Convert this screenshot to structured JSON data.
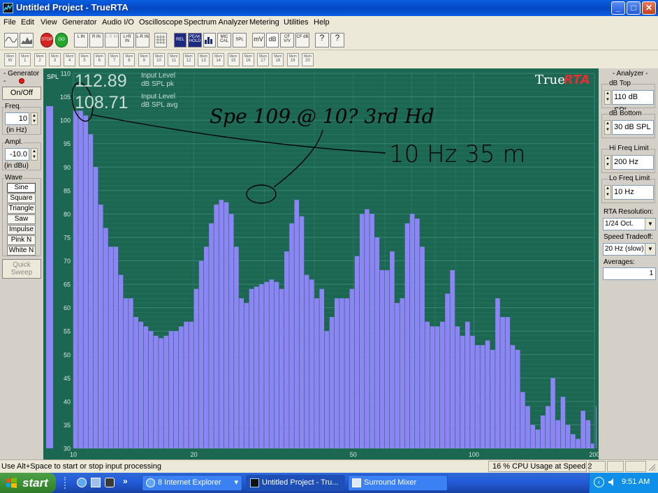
{
  "window": {
    "title": "Untitled Project - TrueRTA",
    "minimize_glyph": "_",
    "maximize_glyph": "□",
    "close_glyph": "✕"
  },
  "menu": [
    "File",
    "Edit",
    "View",
    "Generator",
    "Audio I/O",
    "Oscilloscope",
    "Spectrum Analyzer",
    "Metering",
    "Utilities",
    "Help"
  ],
  "toolbar": {
    "stop": "STOP",
    "go": "GO",
    "l_in": "L IN",
    "r_in": "R IN",
    "l_r_in_disabled": "L R IN",
    "l_plus_r_in": "L+R IN",
    "l_minus_r_in": "L-R IN",
    "rel": "REL",
    "peak_hold": "PEAK HOLD",
    "mic_cal": "MIC CAL",
    "spl": "SPL",
    "mv": "mV",
    "db": "dB",
    "cf_vv": "CF V/V",
    "cf_db": "CF dB",
    "help": "?",
    "context_help": "?"
  },
  "memories": [
    {
      "top": "Mem",
      "num": "W"
    },
    {
      "top": "Mem",
      "num": "1"
    },
    {
      "top": "Mem",
      "num": "2"
    },
    {
      "top": "Mem",
      "num": "3"
    },
    {
      "top": "Mem",
      "num": "4"
    },
    {
      "top": "Mem",
      "num": "5"
    },
    {
      "top": "Mem",
      "num": "6"
    },
    {
      "top": "Mem",
      "num": "7"
    },
    {
      "top": "Mem",
      "num": "8"
    },
    {
      "top": "Mem",
      "num": "9"
    },
    {
      "top": "Mem",
      "num": "10"
    },
    {
      "top": "Mem",
      "num": "11"
    },
    {
      "top": "Mem",
      "num": "12"
    },
    {
      "top": "Mem",
      "num": "13"
    },
    {
      "top": "Mem",
      "num": "14"
    },
    {
      "top": "Mem",
      "num": "15"
    },
    {
      "top": "Mem",
      "num": "16"
    },
    {
      "top": "Mem",
      "num": "17"
    },
    {
      "top": "Mem",
      "num": "18"
    },
    {
      "top": "Mem",
      "num": "19"
    },
    {
      "top": "Mem",
      "num": "20"
    }
  ],
  "generator": {
    "title": "- Generator -",
    "on_off": "On/Off",
    "freq_label": "Freq.",
    "freq_value": "10",
    "freq_unit": "(in Hz)",
    "ampl_label": "Ampl.",
    "ampl_value": "-10.0",
    "ampl_unit": "(in dBu)",
    "wave_label": "Wave",
    "waves": [
      "Sine",
      "Square",
      "Triangle",
      "Saw",
      "Impulse",
      "Pink N",
      "White N"
    ],
    "selected_wave": "Sine",
    "quick_sweep": [
      "Quick",
      "Sweep"
    ]
  },
  "readout": {
    "peak_value": "112.89",
    "peak_label_1": "Input Level",
    "peak_label_2": "dB SPL pk",
    "avg_value": "108.71",
    "avg_label_1": "Input Level",
    "avg_label_2": "dB SPL avg",
    "brand_true": "True",
    "brand_rta": "RTA"
  },
  "annotations": {
    "line1": "Spe 109.@ 10? 3rd Hd",
    "line2": "10 Hz  35 m"
  },
  "analyzer": {
    "title": "- Analyzer -",
    "db_top_label": "dB Top",
    "db_top_value": "110 dB SPL",
    "db_bottom_label": "dB Bottom",
    "db_bottom_value": "30 dB SPL",
    "hi_freq_label": "Hi Freq Limit",
    "hi_freq_value": "200 Hz",
    "lo_freq_label": "Lo Freq Limit",
    "lo_freq_value": "10 Hz",
    "resolution_label": "RTA Resolution:",
    "resolution_value": "1/24 Oct.",
    "speed_label": "Speed Tradeoff:",
    "speed_value": "20 Hz (slow)",
    "averages_label": "Averages:",
    "averages_value": "1"
  },
  "status": {
    "hint": "Use Alt+Space to start or stop input processing",
    "cpu": "16 % CPU Usage at Speed 2"
  },
  "taskbar": {
    "start": "start",
    "tasks": [
      "8 Internet Explorer",
      "Untitled Project - Tru...",
      "Surround Mixer"
    ],
    "clock": "9:51 AM"
  },
  "colors": {
    "plot_bg": "#1c6752",
    "bar": "#8d85f5",
    "grid": "#3d8a74",
    "readout": "#c8ddd5"
  },
  "chart_data": {
    "type": "bar",
    "x_scale": "log",
    "x_range_hz": [
      10,
      200
    ],
    "ylim": [
      30,
      110
    ],
    "ylabel": "SPL",
    "y_ticks": [
      30,
      35,
      40,
      45,
      50,
      55,
      60,
      65,
      70,
      75,
      80,
      85,
      90,
      95,
      100,
      105,
      110
    ],
    "x_ticks": [
      "10",
      "20",
      "50",
      "100",
      "200"
    ],
    "x_tick_values": [
      10,
      20,
      50,
      100,
      200
    ],
    "bands_per_octave": 24,
    "input_meter_level": 103,
    "values": [
      102,
      102,
      101,
      97,
      90,
      82,
      77,
      73,
      73,
      67,
      62,
      62,
      58,
      57,
      56,
      55,
      54,
      53.5,
      54,
      55,
      55,
      56,
      57,
      57,
      64,
      70,
      73,
      78,
      82,
      83,
      82.5,
      80,
      73,
      62,
      61,
      64,
      64.5,
      65,
      65.5,
      66,
      65.5,
      64,
      72,
      78,
      83,
      79.5,
      67,
      66,
      62,
      64,
      55,
      58,
      62,
      62,
      62,
      64,
      71,
      80,
      81,
      80,
      75,
      68,
      68,
      72,
      61,
      62,
      78,
      80,
      79,
      73,
      57,
      56,
      56,
      57,
      63,
      68,
      56,
      54,
      57,
      54,
      52,
      52,
      53,
      51,
      62,
      58,
      58,
      52,
      51,
      42,
      39,
      35,
      34,
      37,
      39,
      45,
      36,
      41,
      35,
      33,
      32,
      38,
      36,
      31,
      39,
      40,
      44,
      48,
      50,
      36,
      34,
      36,
      35,
      34,
      35,
      36,
      33,
      34,
      45,
      46,
      33,
      34,
      38,
      31,
      34,
      37
    ]
  }
}
